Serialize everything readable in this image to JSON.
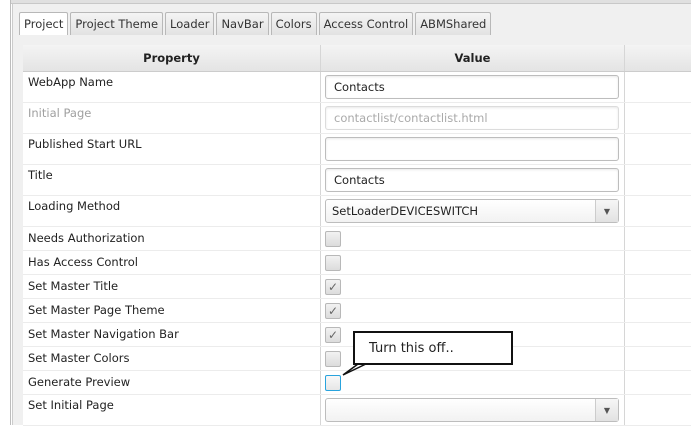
{
  "tabs": [
    "Project",
    "Project Theme",
    "Loader",
    "NavBar",
    "Colors",
    "Access Control",
    "ABMShared"
  ],
  "active_tab": "Project",
  "table": {
    "headers": [
      "Property",
      "Value"
    ]
  },
  "rows": [
    {
      "label": "WebApp Name",
      "type": "text",
      "value": "Contacts"
    },
    {
      "label": "Initial Page",
      "type": "text",
      "value": "contactlist/contactlist.html",
      "disabled": true
    },
    {
      "label": "Published Start URL",
      "type": "text",
      "value": ""
    },
    {
      "label": "Title",
      "type": "text",
      "value": "Contacts"
    },
    {
      "label": "Loading Method",
      "type": "select",
      "value": "SetLoaderDEVICESWITCH"
    },
    {
      "label": "Needs Authorization",
      "type": "checkbox",
      "checked": false
    },
    {
      "label": "Has Access Control",
      "type": "checkbox",
      "checked": false
    },
    {
      "label": "Set Master Title",
      "type": "checkbox",
      "checked": true
    },
    {
      "label": "Set Master Page Theme",
      "type": "checkbox",
      "checked": true
    },
    {
      "label": "Set Master Navigation Bar",
      "type": "checkbox",
      "checked": true
    },
    {
      "label": "Set Master Colors",
      "type": "checkbox",
      "checked": false
    },
    {
      "label": "Generate Preview",
      "type": "checkbox",
      "checked": false,
      "focused": true
    },
    {
      "label": "Set Initial Page",
      "type": "select",
      "value": ""
    }
  ],
  "callout": {
    "text": "Turn this off.."
  }
}
